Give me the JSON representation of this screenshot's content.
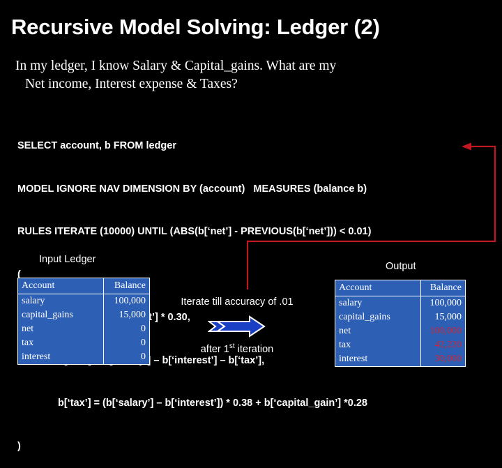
{
  "slide": {
    "title": "Recursive Model Solving: Ledger (2)",
    "body_line1": "In my ledger, I know Salary & Capital_gains.  What are my",
    "body_line2": "Net income,  Interest expense  & Taxes?"
  },
  "sql": {
    "lines": [
      "SELECT account, b FROM ledger",
      "MODEL IGNORE NAV DIMENSION BY (account)   MEASURES (balance b)",
      "RULES ITERATE (10000) UNTIL (ABS(b[‘net’] - PREVIOUS(b[‘net’])) < 0.01)",
      "(",
      "b[‘interest’] = b[‘net’] * 0.30,",
      "b[‘net’] = b[‘salary’] – b[‘interest’] – b[‘tax’],",
      "b[‘tax’] = (b[‘salary’] – b[‘interest’]) * 0.38 + b[‘capital_gain’] *0.28",
      ")"
    ],
    "indented": [
      false,
      false,
      false,
      false,
      true,
      true,
      true,
      false
    ]
  },
  "input_table": {
    "caption": "Input Ledger",
    "headers": [
      "Account",
      "Balance"
    ],
    "rows": [
      {
        "account": "salary",
        "balance": "100,000",
        "highlight": false
      },
      {
        "account": "capital_gains",
        "balance": "15,000",
        "highlight": false
      },
      {
        "account": "net",
        "balance": "0",
        "highlight": false
      },
      {
        "account": "tax",
        "balance": "0",
        "highlight": false
      },
      {
        "account": "interest",
        "balance": "0",
        "highlight": false
      }
    ]
  },
  "output_table": {
    "caption": "Output",
    "headers": [
      "Account",
      "Balance"
    ],
    "rows": [
      {
        "account": "salary",
        "balance": "100,000",
        "highlight": false
      },
      {
        "account": "capital_gains",
        "balance": "15,000",
        "highlight": false
      },
      {
        "account": "net",
        "balance": "100,000",
        "highlight": true
      },
      {
        "account": "tax",
        "balance": "42,220",
        "highlight": true
      },
      {
        "account": "interest",
        "balance": "30,000",
        "highlight": true
      }
    ]
  },
  "center": {
    "iterate_note": "Iterate till accuracy of .01",
    "after_note_prefix": "after 1",
    "after_note_sup": "st",
    "after_note_suffix": " iteration"
  },
  "colors": {
    "background": "#000000",
    "table_fill": "#2d5fb4",
    "table_border": "#ffffff",
    "text": "#ffffff",
    "highlight_value": "#cc2436",
    "loop_arrow": "#c01822",
    "block_arrow_fill": "#1b3fc4",
    "block_arrow_outline": "#ffffff"
  },
  "icons": {
    "loop_arrow": "feedback-loop-arrow",
    "block_arrow": "right-block-arrow"
  }
}
